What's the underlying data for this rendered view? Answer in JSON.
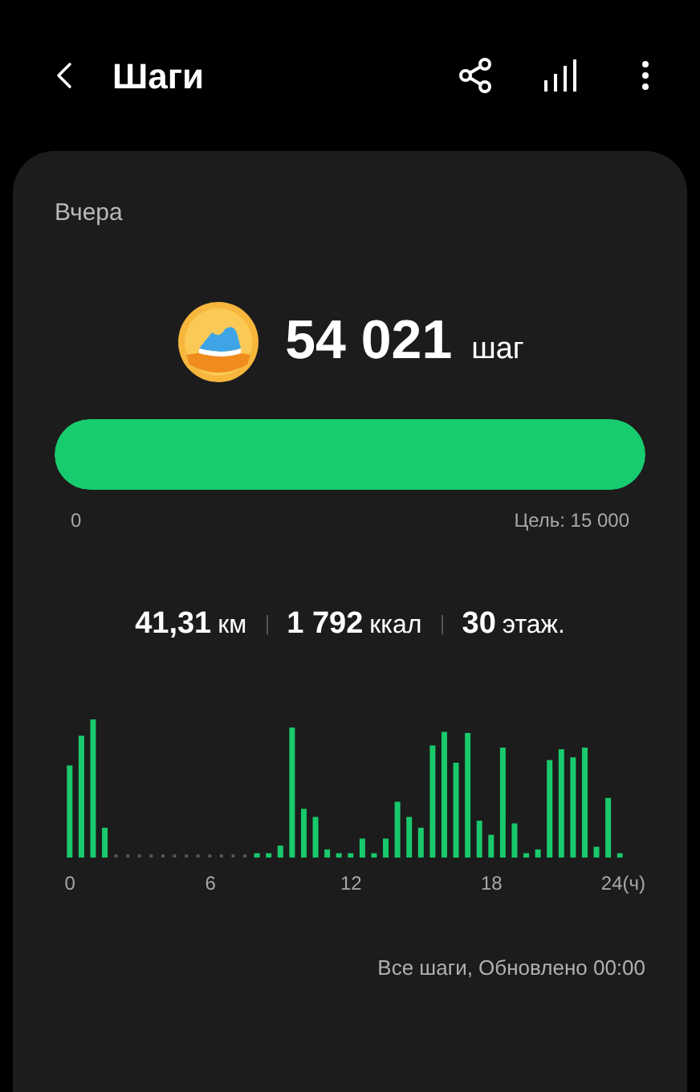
{
  "header": {
    "title": "Шаги"
  },
  "card": {
    "day": "Вчера",
    "steps": "54 021",
    "steps_unit": "шаг",
    "progress": {
      "level": 1,
      "min_label": "0",
      "goal_label": "Цель: 15 000"
    },
    "stats": [
      {
        "value": "41,31",
        "unit": "км"
      },
      {
        "value": "1 792",
        "unit": "ккал"
      },
      {
        "value": "30",
        "unit": "этаж."
      }
    ],
    "chart": {
      "x_labels": [
        "0",
        "6",
        "12",
        "18",
        "24(ч)"
      ]
    },
    "footer": "Все шаги, Обновлено 00:00"
  }
}
